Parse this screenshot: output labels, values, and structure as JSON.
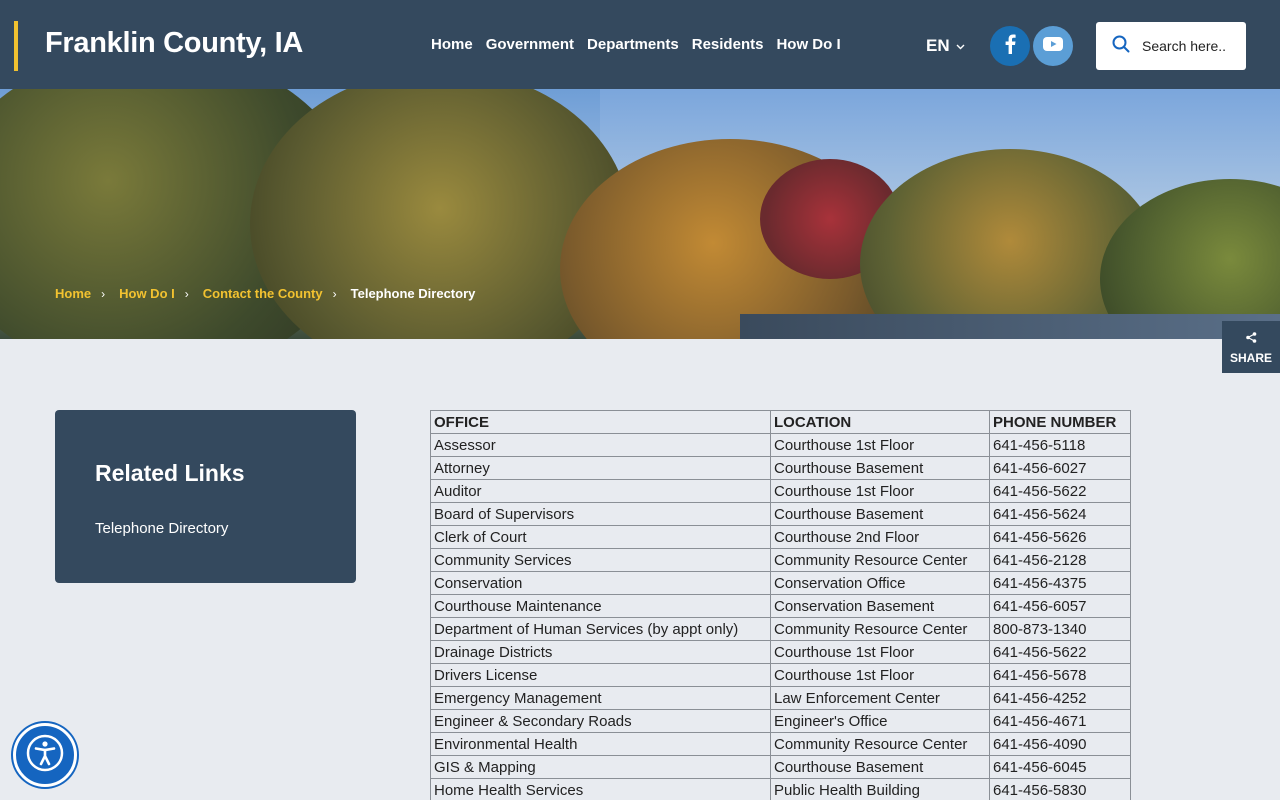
{
  "header": {
    "site_title": "Franklin County, IA",
    "nav": [
      "Home",
      "Government",
      "Departments",
      "Residents",
      "How Do I"
    ],
    "language": "EN",
    "social": [
      {
        "name": "facebook-icon",
        "glyph": "f"
      },
      {
        "name": "youtube-icon"
      }
    ],
    "search_placeholder": "Search here.."
  },
  "breadcrumb": {
    "items": [
      "Home",
      "How Do I",
      "Contact the County"
    ],
    "current": "Telephone Directory"
  },
  "share": {
    "label": "SHARE"
  },
  "sidebar": {
    "title": "Related Links",
    "links": [
      "Telephone Directory"
    ]
  },
  "directory": {
    "columns": [
      "OFFICE",
      "LOCATION",
      "PHONE NUMBER"
    ],
    "rows": [
      [
        "Assessor",
        "Courthouse 1st Floor",
        "641-456-5118"
      ],
      [
        "Attorney",
        "Courthouse Basement",
        "641-456-6027"
      ],
      [
        "Auditor",
        "Courthouse 1st Floor",
        "641-456-5622"
      ],
      [
        "Board of Supervisors",
        "Courthouse Basement",
        "641-456-5624"
      ],
      [
        "Clerk of Court",
        "Courthouse 2nd Floor",
        "641-456-5626"
      ],
      [
        "Community Services",
        "Community Resource Center",
        "641-456-2128"
      ],
      [
        "Conservation",
        "Conservation Office",
        "641-456-4375"
      ],
      [
        "Courthouse Maintenance",
        "Conservation Basement",
        "641-456-6057"
      ],
      [
        "Department of Human Services (by appt only)",
        "Community Resource Center",
        "800-873-1340"
      ],
      [
        "Drainage Districts",
        "Courthouse 1st Floor",
        "641-456-5622"
      ],
      [
        "Drivers License",
        "Courthouse 1st Floor",
        "641-456-5678"
      ],
      [
        "Emergency Management",
        "Law Enforcement Center",
        "641-456-4252"
      ],
      [
        "Engineer & Secondary Roads",
        "Engineer's Office",
        "641-456-4671"
      ],
      [
        "Environmental Health",
        "Community Resource Center",
        "641-456-4090"
      ],
      [
        "GIS & Mapping",
        "Courthouse Basement",
        "641-456-6045"
      ],
      [
        "Home Health Services",
        "Public Health Building",
        "641-456-5830"
      ]
    ]
  },
  "colors": {
    "header_bg": "#34495e",
    "accent": "#f2c230",
    "page_bg": "#e8ebf0"
  }
}
